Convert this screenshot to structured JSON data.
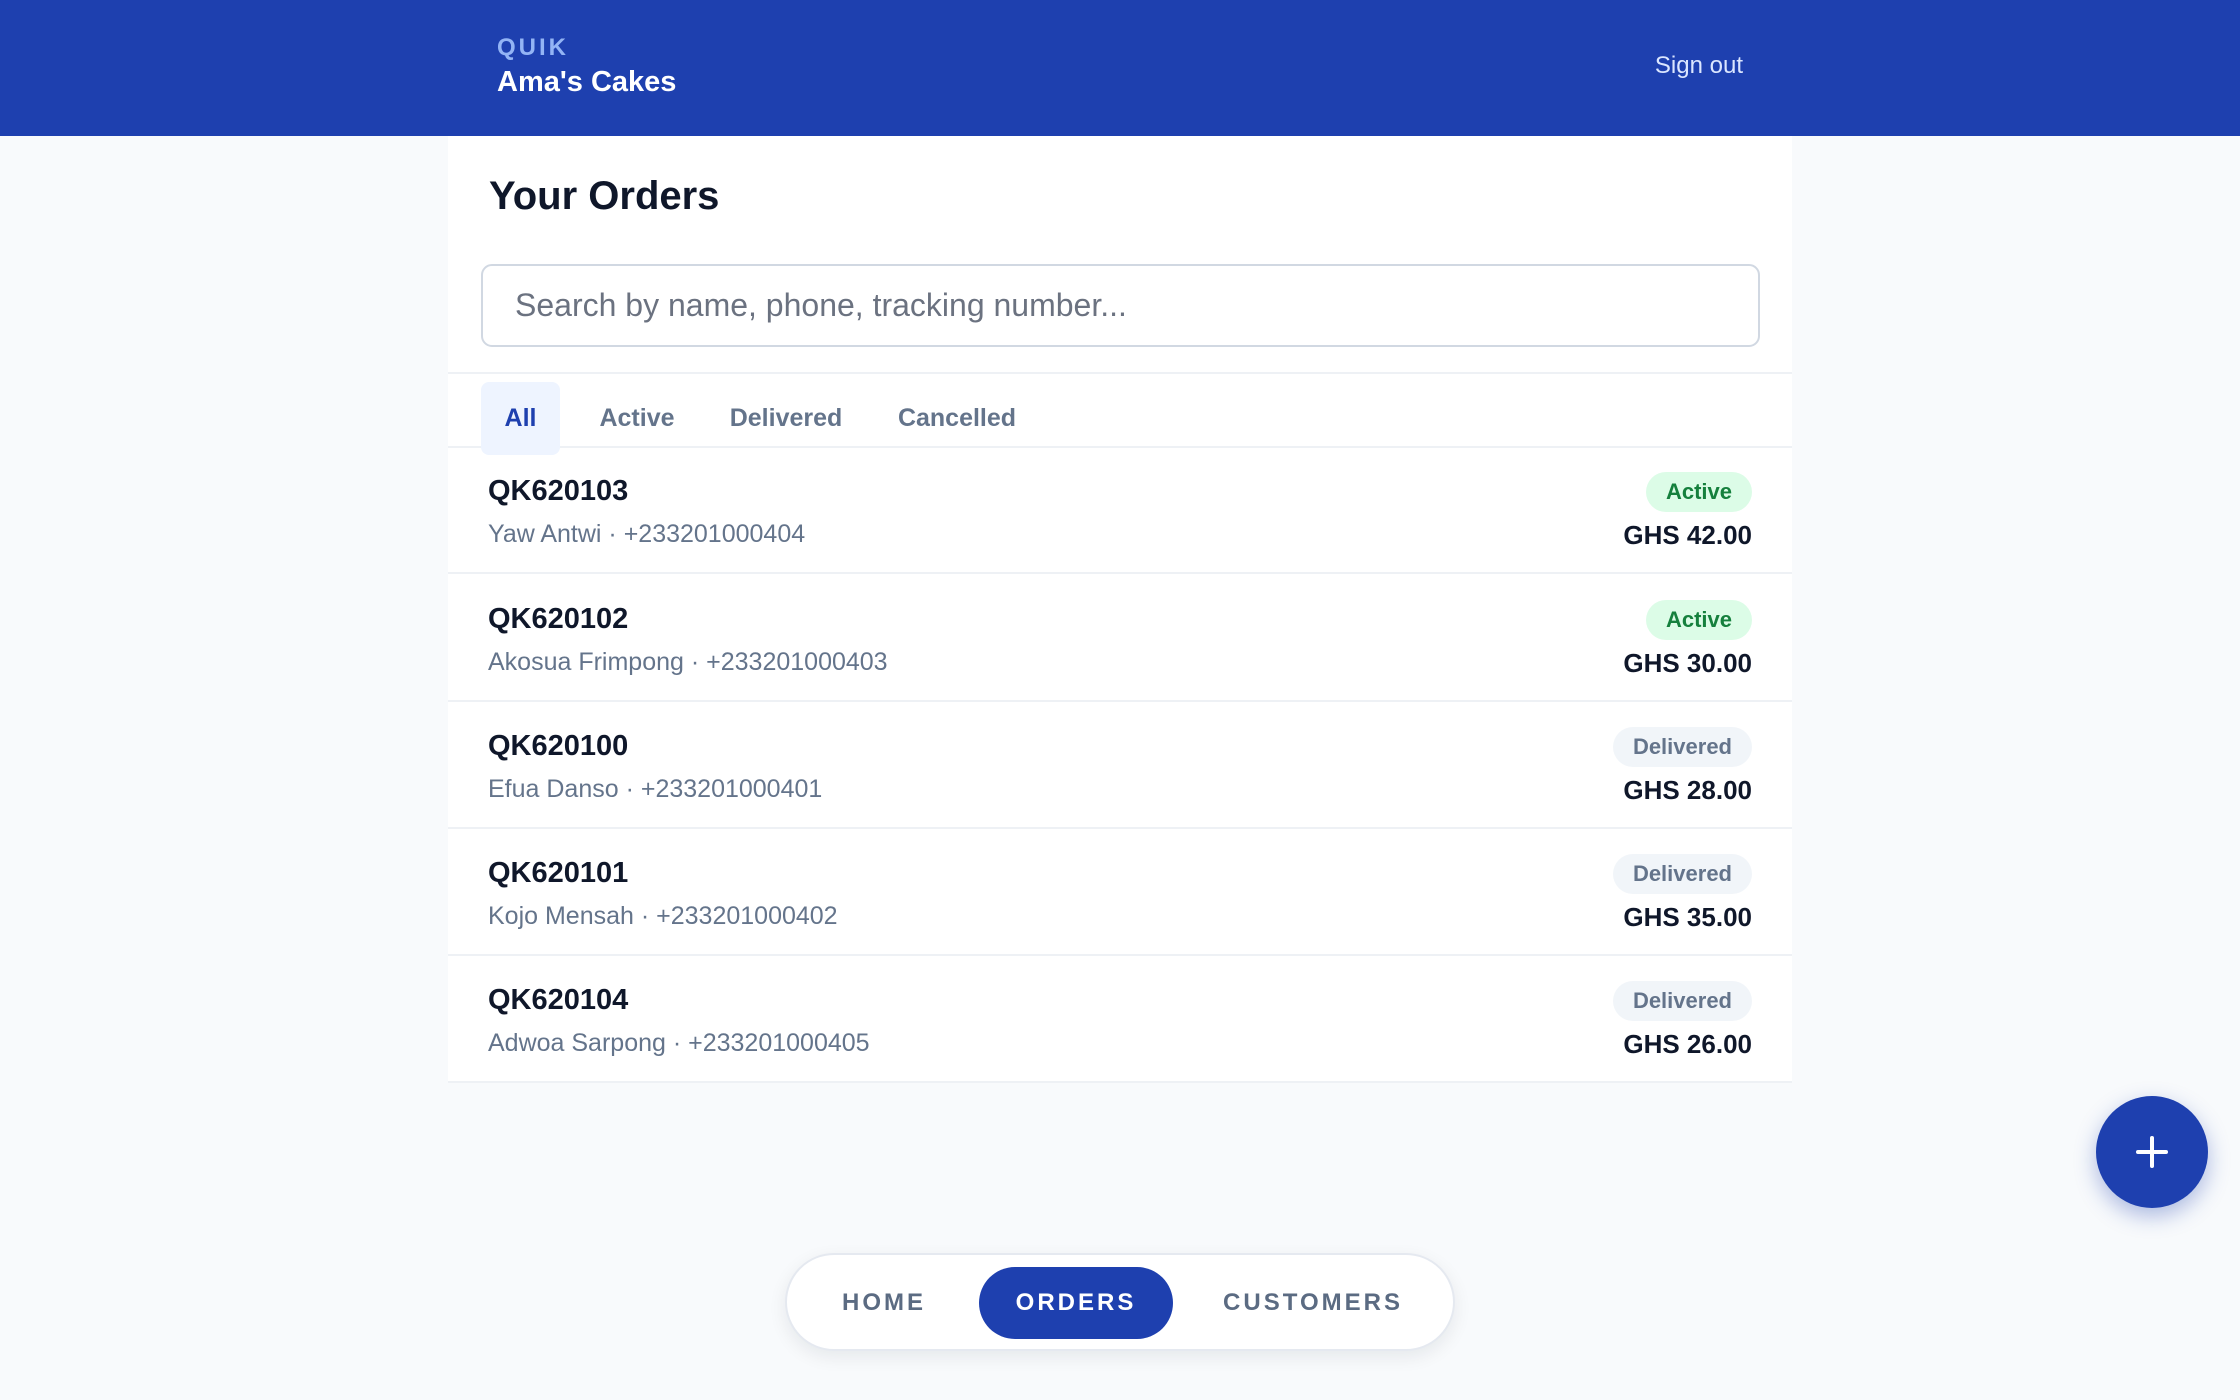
{
  "header": {
    "brand": "QUIK",
    "business_name": "Ama's Cakes",
    "sign_out": "Sign out"
  },
  "page": {
    "title": "Your Orders"
  },
  "search": {
    "placeholder": "Search by name, phone, tracking number...",
    "value": ""
  },
  "filters": {
    "tabs": [
      {
        "label": "All",
        "active": true
      },
      {
        "label": "Active",
        "active": false
      },
      {
        "label": "Delivered",
        "active": false
      },
      {
        "label": "Cancelled",
        "active": false
      }
    ]
  },
  "orders": [
    {
      "id": "QK620103",
      "meta": "Yaw Antwi · +233201000404",
      "status": "Active",
      "amount": "GHS 42.00"
    },
    {
      "id": "QK620102",
      "meta": "Akosua Frimpong · +233201000403",
      "status": "Active",
      "amount": "GHS 30.00"
    },
    {
      "id": "QK620100",
      "meta": "Efua Danso · +233201000401",
      "status": "Delivered",
      "amount": "GHS 28.00"
    },
    {
      "id": "QK620101",
      "meta": "Kojo Mensah · +233201000402",
      "status": "Delivered",
      "amount": "GHS 35.00"
    },
    {
      "id": "QK620104",
      "meta": "Adwoa Sarpong · +233201000405",
      "status": "Delivered",
      "amount": "GHS 26.00"
    }
  ],
  "fab": {
    "icon": "plus-icon"
  },
  "bottom_nav": {
    "items": [
      {
        "label": "HOME",
        "active": false
      },
      {
        "label": "ORDERS",
        "active": true
      },
      {
        "label": "CUSTOMERS",
        "active": false
      }
    ]
  },
  "colors": {
    "primary": "#1e40af",
    "active_badge_bg": "#dcfce7",
    "active_badge_text": "#15803d",
    "delivered_badge_bg": "#f1f5f9",
    "delivered_badge_text": "#64748b"
  }
}
